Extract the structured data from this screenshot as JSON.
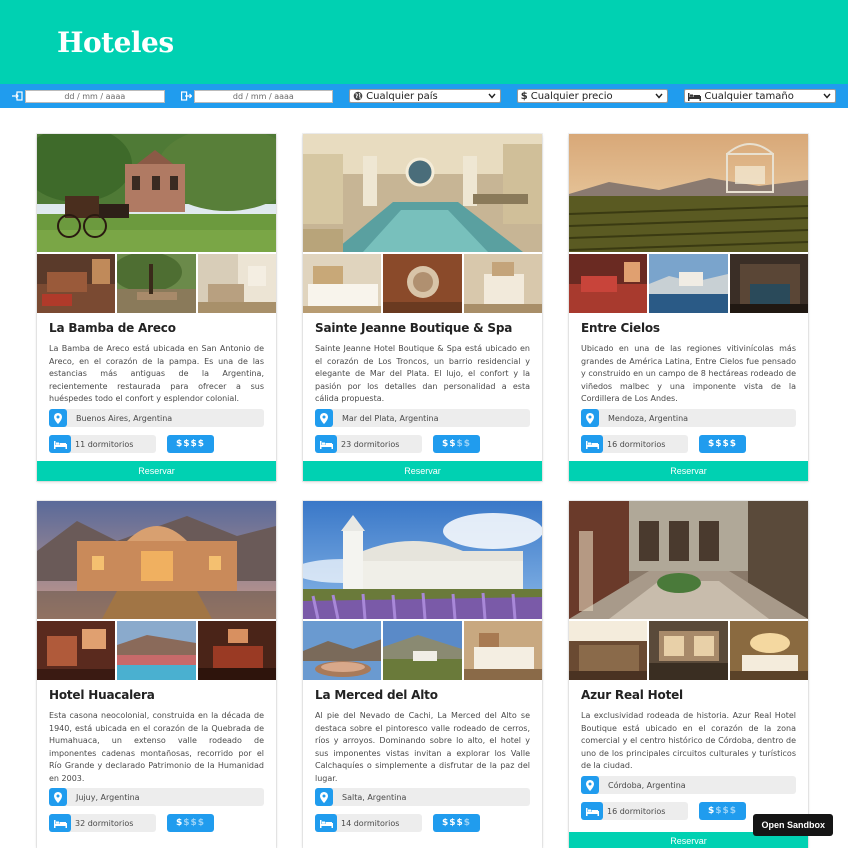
{
  "header": {
    "title": "Hoteles"
  },
  "filters": {
    "date_from_placeholder": "dd / mm / aaaa",
    "date_to_placeholder": "dd / mm / aaaa",
    "country": "Cualquier país",
    "price": "Cualquier precio",
    "size": "Cualquier tamaño"
  },
  "hotels": [
    {
      "name": "La Bamba de Areco",
      "description": "La Bamba de Areco está ubicada en San Antonio de Areco, en el corazón de la pampa. Es una de las estancias más antiguas de la Argentina, recientemente restaurada para ofrecer a sus huéspedes todo el confort y esplendor colonial.",
      "location": "Buenos Aires, Argentina",
      "rooms": "11 dormitorios",
      "price_on": "$$$$",
      "price_off": "",
      "reserve": "Reservar"
    },
    {
      "name": "Sainte Jeanne Boutique & Spa",
      "description": "Sainte Jeanne Hotel Boutique & Spa está ubicado en el corazón de Los Troncos, un barrio residencial y elegante de Mar del Plata. El lujo, el confort y la pasión por los detalles dan personalidad a esta cálida propuesta.",
      "location": "Mar del Plata, Argentina",
      "rooms": "23 dormitorios",
      "price_on": "$$",
      "price_off": "$$",
      "reserve": "Reservar"
    },
    {
      "name": "Entre Cielos",
      "description": "Ubicado en una de las regiones vitivinícolas más grandes de América Latina, Entre Cielos fue pensado y construido en un campo de 8 hectáreas rodeado de viñedos malbec y una imponente vista de la Cordillera de Los Andes.",
      "location": "Mendoza, Argentina",
      "rooms": "16 dormitorios",
      "price_on": "$$$$",
      "price_off": "",
      "reserve": "Reservar"
    },
    {
      "name": "Hotel Huacalera",
      "description": "Esta casona neocolonial, construida en la década de 1940, está ubicada en el corazón de la Quebrada de Humahuaca, un extenso valle rodeado de imponentes cadenas montañosas, recorrido por el Río Grande y declarado Patrimonio de la Humanidad en 2003.",
      "location": "Jujuy, Argentina",
      "rooms": "32 dormitorios",
      "price_on": "$",
      "price_off": "$$$",
      "reserve": "Reservar"
    },
    {
      "name": "La Merced del Alto",
      "description": "Al pie del Nevado de Cachi, La Merced del Alto se destaca sobre el pintoresco valle rodeado de cerros, ríos y arroyos. Dominando sobre lo alto, el hotel y sus imponentes vistas invitan a explorar los Valle Calchaquíes o simplemente a disfrutar de la paz del lugar.",
      "location": "Salta, Argentina",
      "rooms": "14 dormitorios",
      "price_on": "$$$",
      "price_off": "$",
      "reserve": "Reservar"
    },
    {
      "name": "Azur Real Hotel",
      "description": "La exclusividad rodeada de historia. Azur Real Hotel Boutique está ubicado en el corazón de la zona comercial y el centro histórico de Córdoba, dentro de uno de los principales circuitos culturales y turísticos de la ciudad.",
      "location": "Córdoba, Argentina",
      "rooms": "16 dormitorios",
      "price_on": "$",
      "price_off": "$$$",
      "reserve": "Reservar"
    }
  ],
  "sandbox": {
    "label": "Open Sandbox"
  }
}
